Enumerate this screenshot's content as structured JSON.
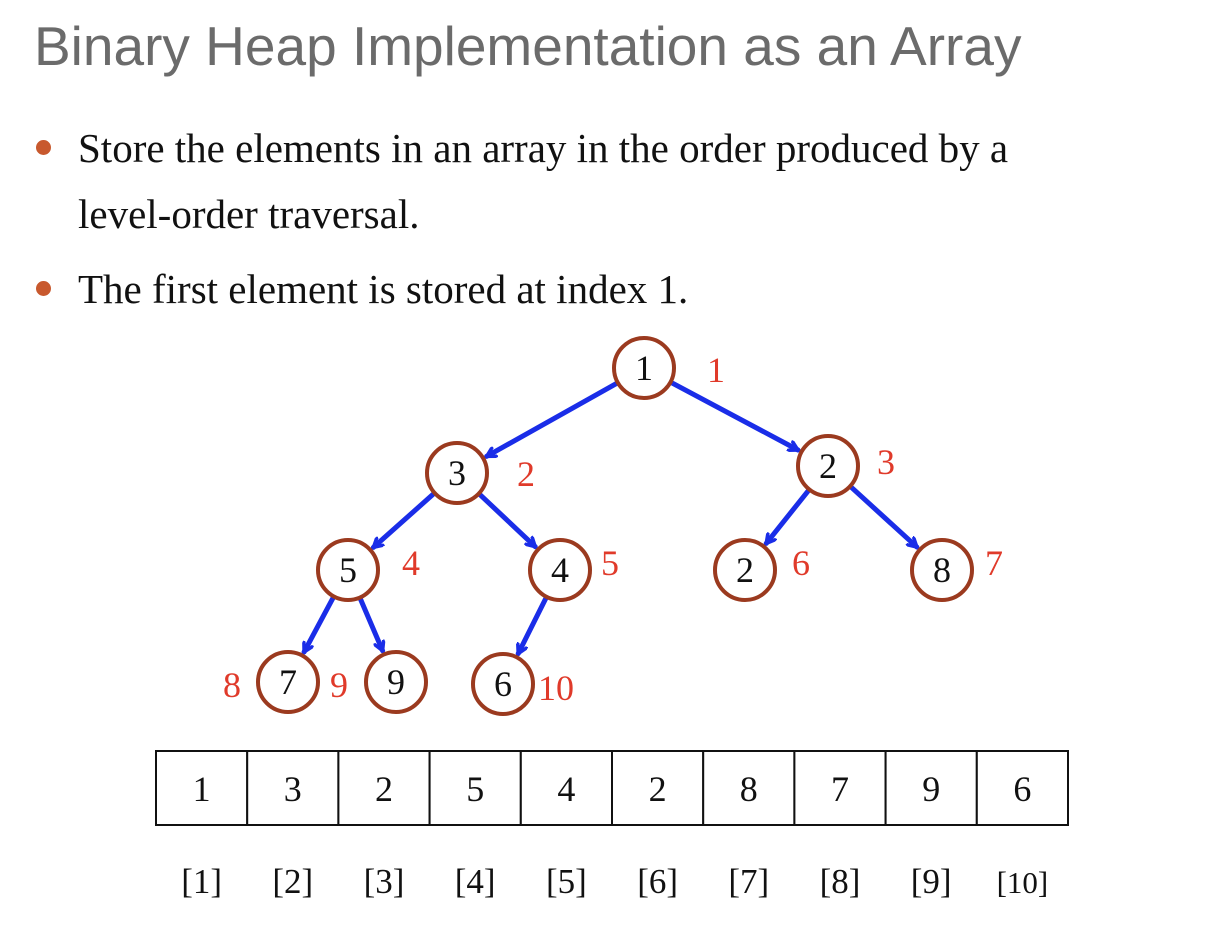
{
  "title": "Binary Heap Implementation as an Array",
  "bullets": [
    {
      "lines": [
        "Store the elements in an array in the order produced by a",
        "level-order traversal."
      ]
    },
    {
      "lines": [
        "The first element is stored at index 1."
      ]
    }
  ],
  "colors": {
    "edge": "#1a2de8",
    "node_border": "#9b3a1f",
    "index": "#e03a2a",
    "bullet": "#c8592e"
  },
  "tree": {
    "nodes": [
      {
        "value": "1",
        "index": "1"
      },
      {
        "value": "3",
        "index": "2"
      },
      {
        "value": "2",
        "index": "3"
      },
      {
        "value": "5",
        "index": "4"
      },
      {
        "value": "4",
        "index": "5"
      },
      {
        "value": "2",
        "index": "6"
      },
      {
        "value": "8",
        "index": "7"
      },
      {
        "value": "7",
        "index": "8"
      },
      {
        "value": "9",
        "index": "9"
      },
      {
        "value": "6",
        "index": "10"
      }
    ]
  },
  "array": {
    "values": [
      "1",
      "3",
      "2",
      "5",
      "4",
      "2",
      "8",
      "7",
      "9",
      "6"
    ],
    "labels": [
      "[1]",
      "[2]",
      "[3]",
      "[4]",
      "[5]",
      "[6]",
      "[7]",
      "[8]",
      "[9]",
      "[10]"
    ]
  }
}
